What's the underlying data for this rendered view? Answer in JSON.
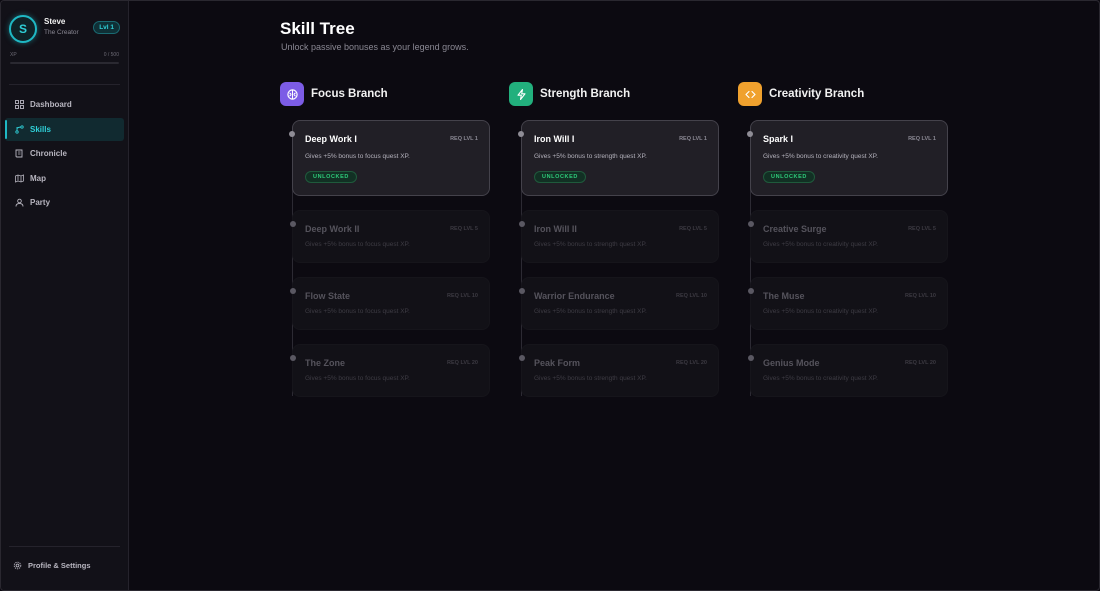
{
  "user": {
    "name": "Steve",
    "title": "The Creator",
    "initial": "S",
    "level": "Lvl 1",
    "xp_label": "XP",
    "xp_value": "0 / 500",
    "xp_progress": 0
  },
  "nav": [
    {
      "label": "Dashboard",
      "icon": "dashboard-icon",
      "active": false
    },
    {
      "label": "Skills",
      "icon": "skills-icon",
      "active": true
    },
    {
      "label": "Chronicle",
      "icon": "chronicle-icon",
      "active": false
    },
    {
      "label": "Map",
      "icon": "map-icon",
      "active": false
    },
    {
      "label": "Party",
      "icon": "party-icon",
      "active": false
    }
  ],
  "settings_label": "Profile & Settings",
  "page": {
    "title": "Skill Tree",
    "subtitle": "Unlock passive bonuses as your legend grows."
  },
  "branches": [
    {
      "name": "Focus Branch",
      "icon": "brain-icon",
      "color": "#7c5ce6",
      "skills": [
        {
          "name": "Deep Work I",
          "req": "REQ LVL 1",
          "desc": "Gives +5% bonus to focus quest XP.",
          "status": "UNLOCKED"
        },
        {
          "name": "Deep Work II",
          "req": "REQ LVL 5",
          "desc": "Gives +5% bonus to focus quest XP."
        },
        {
          "name": "Flow State",
          "req": "REQ LVL 10",
          "desc": "Gives +5% bonus to focus quest XP."
        },
        {
          "name": "The Zone",
          "req": "REQ LVL 20",
          "desc": "Gives +5% bonus to focus quest XP."
        }
      ]
    },
    {
      "name": "Strength Branch",
      "icon": "lightning-icon",
      "color": "#22b07d",
      "skills": [
        {
          "name": "Iron Will I",
          "req": "REQ LVL 1",
          "desc": "Gives +5% bonus to strength quest XP.",
          "status": "UNLOCKED"
        },
        {
          "name": "Iron Will II",
          "req": "REQ LVL 5",
          "desc": "Gives +5% bonus to strength quest XP."
        },
        {
          "name": "Warrior Endurance",
          "req": "REQ LVL 10",
          "desc": "Gives +5% bonus to strength quest XP."
        },
        {
          "name": "Peak Form",
          "req": "REQ LVL 20",
          "desc": "Gives +5% bonus to strength quest XP."
        }
      ]
    },
    {
      "name": "Creativity Branch",
      "icon": "code-icon",
      "color": "#f0a12e",
      "skills": [
        {
          "name": "Spark I",
          "req": "REQ LVL 1",
          "desc": "Gives +5% bonus to creativity quest XP.",
          "status": "UNLOCKED"
        },
        {
          "name": "Creative Surge",
          "req": "REQ LVL 5",
          "desc": "Gives +5% bonus to creativity quest XP."
        },
        {
          "name": "The Muse",
          "req": "REQ LVL 10",
          "desc": "Gives +5% bonus to creativity quest XP."
        },
        {
          "name": "Genius Mode",
          "req": "REQ LVL 20",
          "desc": "Gives +5% bonus to creativity quest XP."
        }
      ]
    }
  ]
}
